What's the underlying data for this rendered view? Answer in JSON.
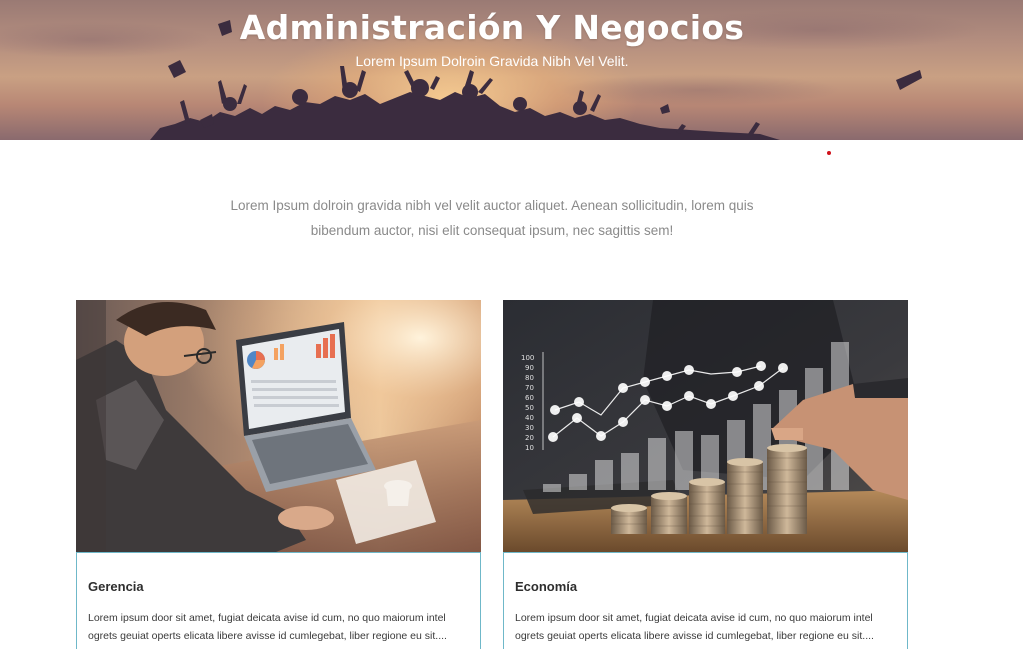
{
  "hero": {
    "title": "Administración Y Negocios",
    "subtitle": "Lorem Ipsum Dolroin Gravida Nibh Vel Velit."
  },
  "intro": {
    "text": "Lorem Ipsum dolroin gravida nibh vel velit auctor aliquet. Aenean sollicitudin, lorem quis bibendum auctor, nisi elit consequat ipsum, nec sagittis sem!"
  },
  "cards": [
    {
      "title": "Gerencia",
      "text": "Lorem ipsum door sit amet, fugiat deicata avise id cum, no quo maiorum intel ogrets geuiat operts elicata libere avisse id cumlegebat, liber regione eu sit...."
    },
    {
      "title": "Economía",
      "text": "Lorem ipsum door sit amet, fugiat deicata avise id cum, no quo maiorum intel ogrets geuiat operts elicata libere avisse id cumlegebat, liber regione eu sit...."
    }
  ],
  "chart_axis_labels": [
    "100",
    "90",
    "80",
    "70",
    "60",
    "50",
    "40",
    "30",
    "20",
    "10"
  ],
  "colors": {
    "accent_border": "#6fb8c9",
    "red_dot": "#d0121b",
    "intro_text": "#8a8a8a"
  }
}
